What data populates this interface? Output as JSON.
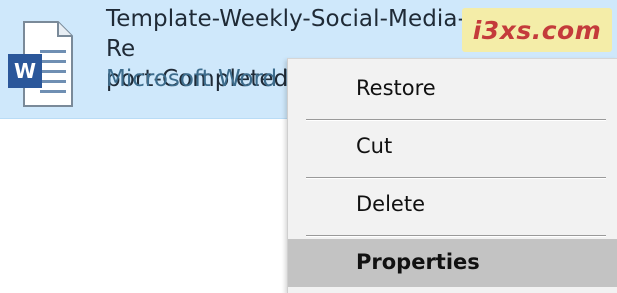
{
  "file": {
    "name_line1": "Template-Weekly-Social-Media-Re",
    "name_line2": "port-Completed.docx",
    "type": "Microsoft Word D",
    "icon": "word-document-icon",
    "selected": true
  },
  "brand_badge": {
    "text": "i3xs.com"
  },
  "context_menu": {
    "items": [
      {
        "label": "Restore"
      },
      {
        "label": "Cut"
      },
      {
        "label": "Delete"
      },
      {
        "label": "Properties",
        "hovered": true
      }
    ]
  },
  "colors": {
    "selection_bg": "#cfe8fb",
    "menu_bg": "#f2f2f2",
    "hover_bg": "#c3c3c3",
    "word_blue": "#2b579a",
    "badge_bg": "#f4eda8",
    "badge_text": "#c43b3b"
  }
}
